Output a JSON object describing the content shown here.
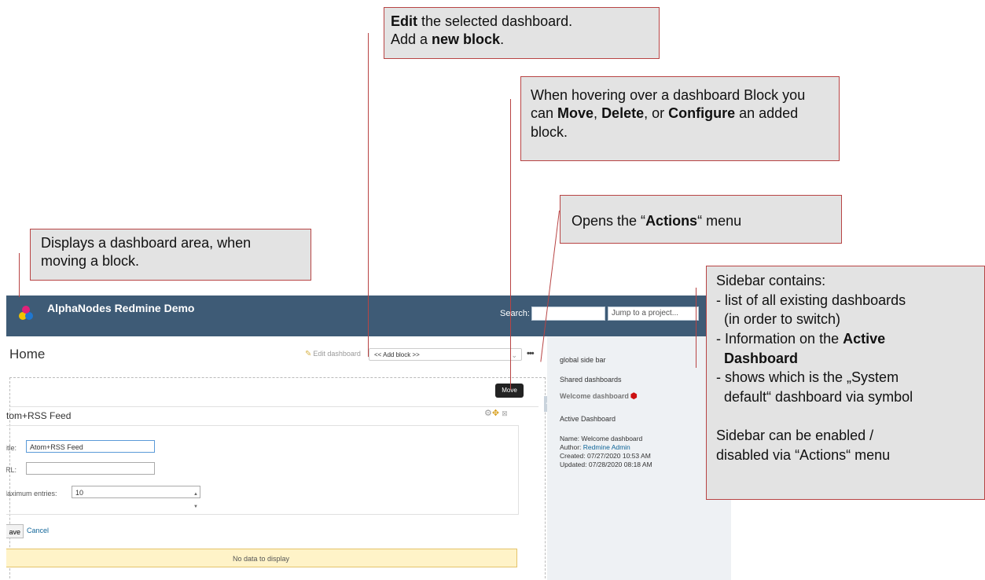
{
  "app": {
    "title": "AlphaNodes Redmine Demo",
    "search_label": "Search:",
    "search_value": "",
    "jump_placeholder": "Jump to a project..."
  },
  "main": {
    "page_title": "Home",
    "edit_label": "Edit dashboard",
    "add_block_label": "<< Add block >>",
    "actions_dots": "•••",
    "move_tooltip": "Move",
    "block_title": "tom+RSS Feed",
    "form": {
      "title_label": "itle:",
      "title_value": "Atom+RSS Feed",
      "url_label": "RL:",
      "url_value": "",
      "max_label": "laximum entries:",
      "max_value": "10"
    },
    "save_label": "ave",
    "cancel_label": "Cancel",
    "no_data": "No data to display"
  },
  "sidebar": {
    "global": "global side bar",
    "shared": "Shared dashboards",
    "welcome": "Welcome dashboard",
    "active_heading": "Active Dashboard",
    "name_line": "Name: Welcome dashboard",
    "author_label": "Author:",
    "author": "Redmine Admin",
    "created": "Created: 07/27/2020 10:53 AM",
    "updated": "Updated: 07/28/2020 08:18 AM"
  },
  "callouts": {
    "edit": {
      "p1": "Edit",
      "p2": " the selected dashboard.",
      "p3": "Add a ",
      "p4": "new block",
      "p5": "."
    },
    "hover": {
      "p1": "When hovering over a dashboard Block you can ",
      "p2": "Move",
      "p3": ", ",
      "p4": "Delete",
      "p5": ", or ",
      "p6": "Configure",
      "p7": " an added block."
    },
    "actions": {
      "p1": "Opens the “",
      "p2": "Actions",
      "p3": "“ menu"
    },
    "area": {
      "text": "Displays a dashboard area, when moving a block."
    },
    "sidebar": {
      "l1": "Sidebar contains:",
      "l2": "- list of all existing dashboards",
      "l3": "  (in order to switch)",
      "l4a": "- Information on the ",
      "l4b": "Active",
      "l5": "  Dashboard",
      "l6": "- shows which is the „System",
      "l7": "  default“ dashboard via symbol",
      "l8": "Sidebar can be enabled /",
      "l9": "disabled via “Actions“ menu"
    }
  }
}
